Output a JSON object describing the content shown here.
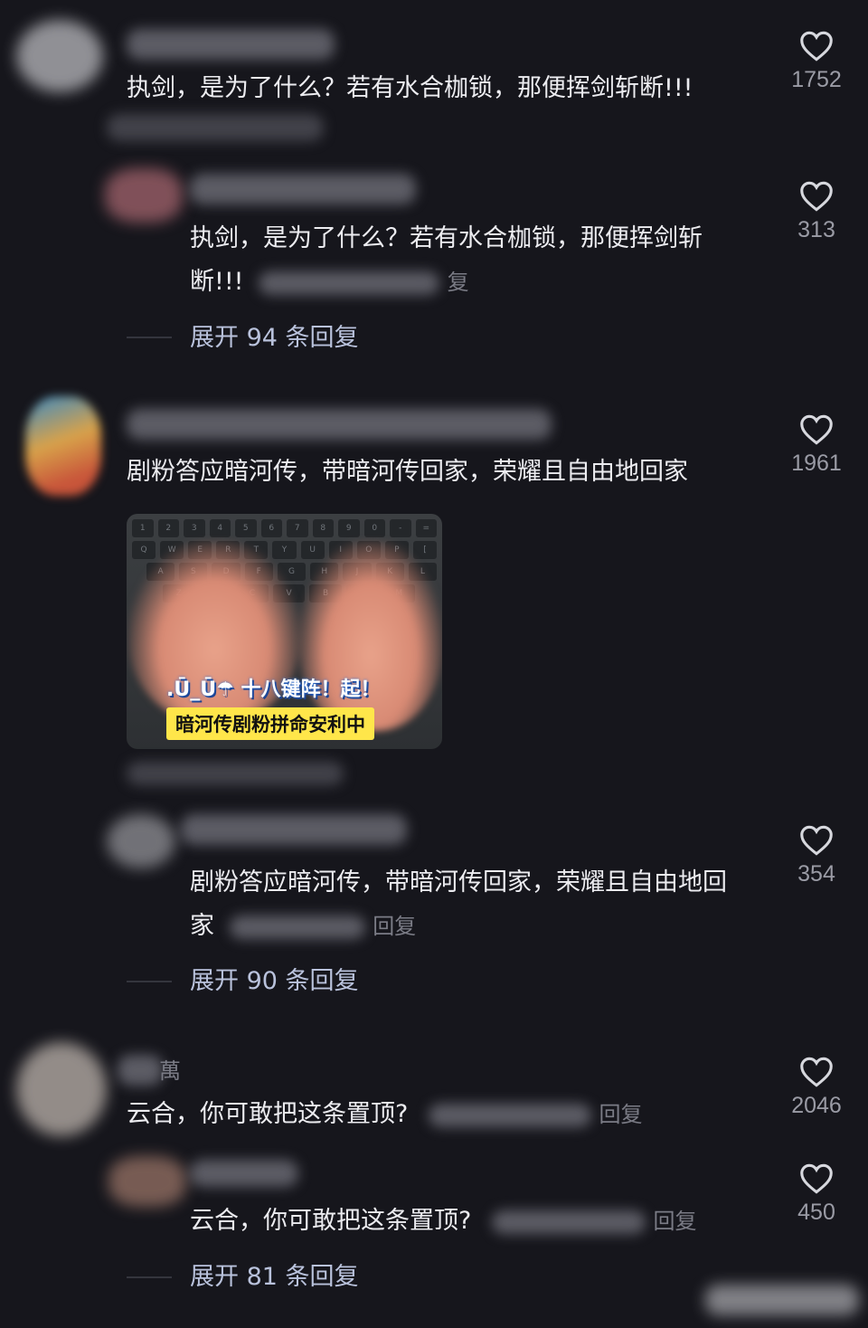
{
  "comments": [
    {
      "text": "执剑，是为了什么？若有水合枷锁，那便挥剑斩断!!!",
      "likes": "1752",
      "replies": [
        {
          "text": "执剑，是为了什么？若有水合枷锁，那便挥剑斩断!!!",
          "meta_tail": "复",
          "likes": "313"
        }
      ],
      "expand_label": "展开 94 条回复"
    },
    {
      "text": "剧粉答应暗河传，带暗河传回家，荣耀且自由地回家",
      "likes": "1961",
      "image": {
        "caption_top": ".Ū_Ū☂ 十八键阵！起！",
        "caption_bottom": "暗河传剧粉拼命安利中"
      },
      "replies": [
        {
          "text": "剧粉答应暗河传，带暗河传回家，荣耀且自由地回家",
          "meta_tail": "回复",
          "likes": "354"
        }
      ],
      "expand_label": "展开 90 条回复"
    },
    {
      "name_fragment": "萬",
      "text": "云合，你可敢把这条置顶?",
      "meta_tail": "回复",
      "likes": "2046",
      "replies": [
        {
          "text": "云合，你可敢把这条置顶?",
          "meta_tail": "回复",
          "likes": "450"
        }
      ],
      "expand_label": "展开 81 条回复"
    }
  ],
  "icons": {
    "like": "heart-icon"
  },
  "colors": {
    "background": "#16161c",
    "expand_text": "#b9c2dc",
    "meta": "#7b7c86"
  }
}
